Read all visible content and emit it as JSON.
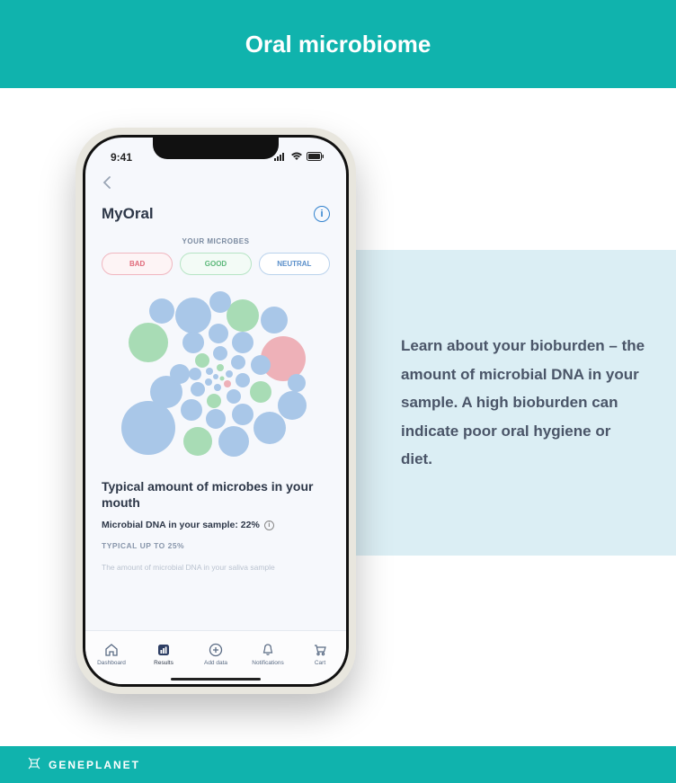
{
  "banner": {
    "title": "Oral microbiome"
  },
  "side_panel": {
    "text": "Learn about your bioburden – the amount of microbial DNA in your sample. A high bioburden can indicate poor oral hygiene or diet."
  },
  "phone": {
    "status": {
      "time": "9:41"
    },
    "app": {
      "title": "MyOral",
      "microbes_label": "YOUR MICROBES",
      "pills": {
        "bad": "BAD",
        "good": "GOOD",
        "neutral": "NEUTRAL"
      },
      "result_title": "Typical amount of microbes in your mouth",
      "dna_line": "Microbial DNA in your sample: 22%",
      "typical_line": "TYPICAL UP TO 25%",
      "cutoff_line": "The amount of microbial DNA in your saliva sample"
    },
    "tabs": {
      "dashboard": "Dashboard",
      "results": "Results",
      "adddata": "Add data",
      "notifications": "Notifications",
      "cart": "Cart"
    }
  },
  "footer": {
    "brand": "GENEPLANET"
  },
  "colors": {
    "teal": "#10b3ad",
    "blue": "#a9c7e8",
    "green": "#a8dcb5",
    "red": "#eeb1b8"
  }
}
